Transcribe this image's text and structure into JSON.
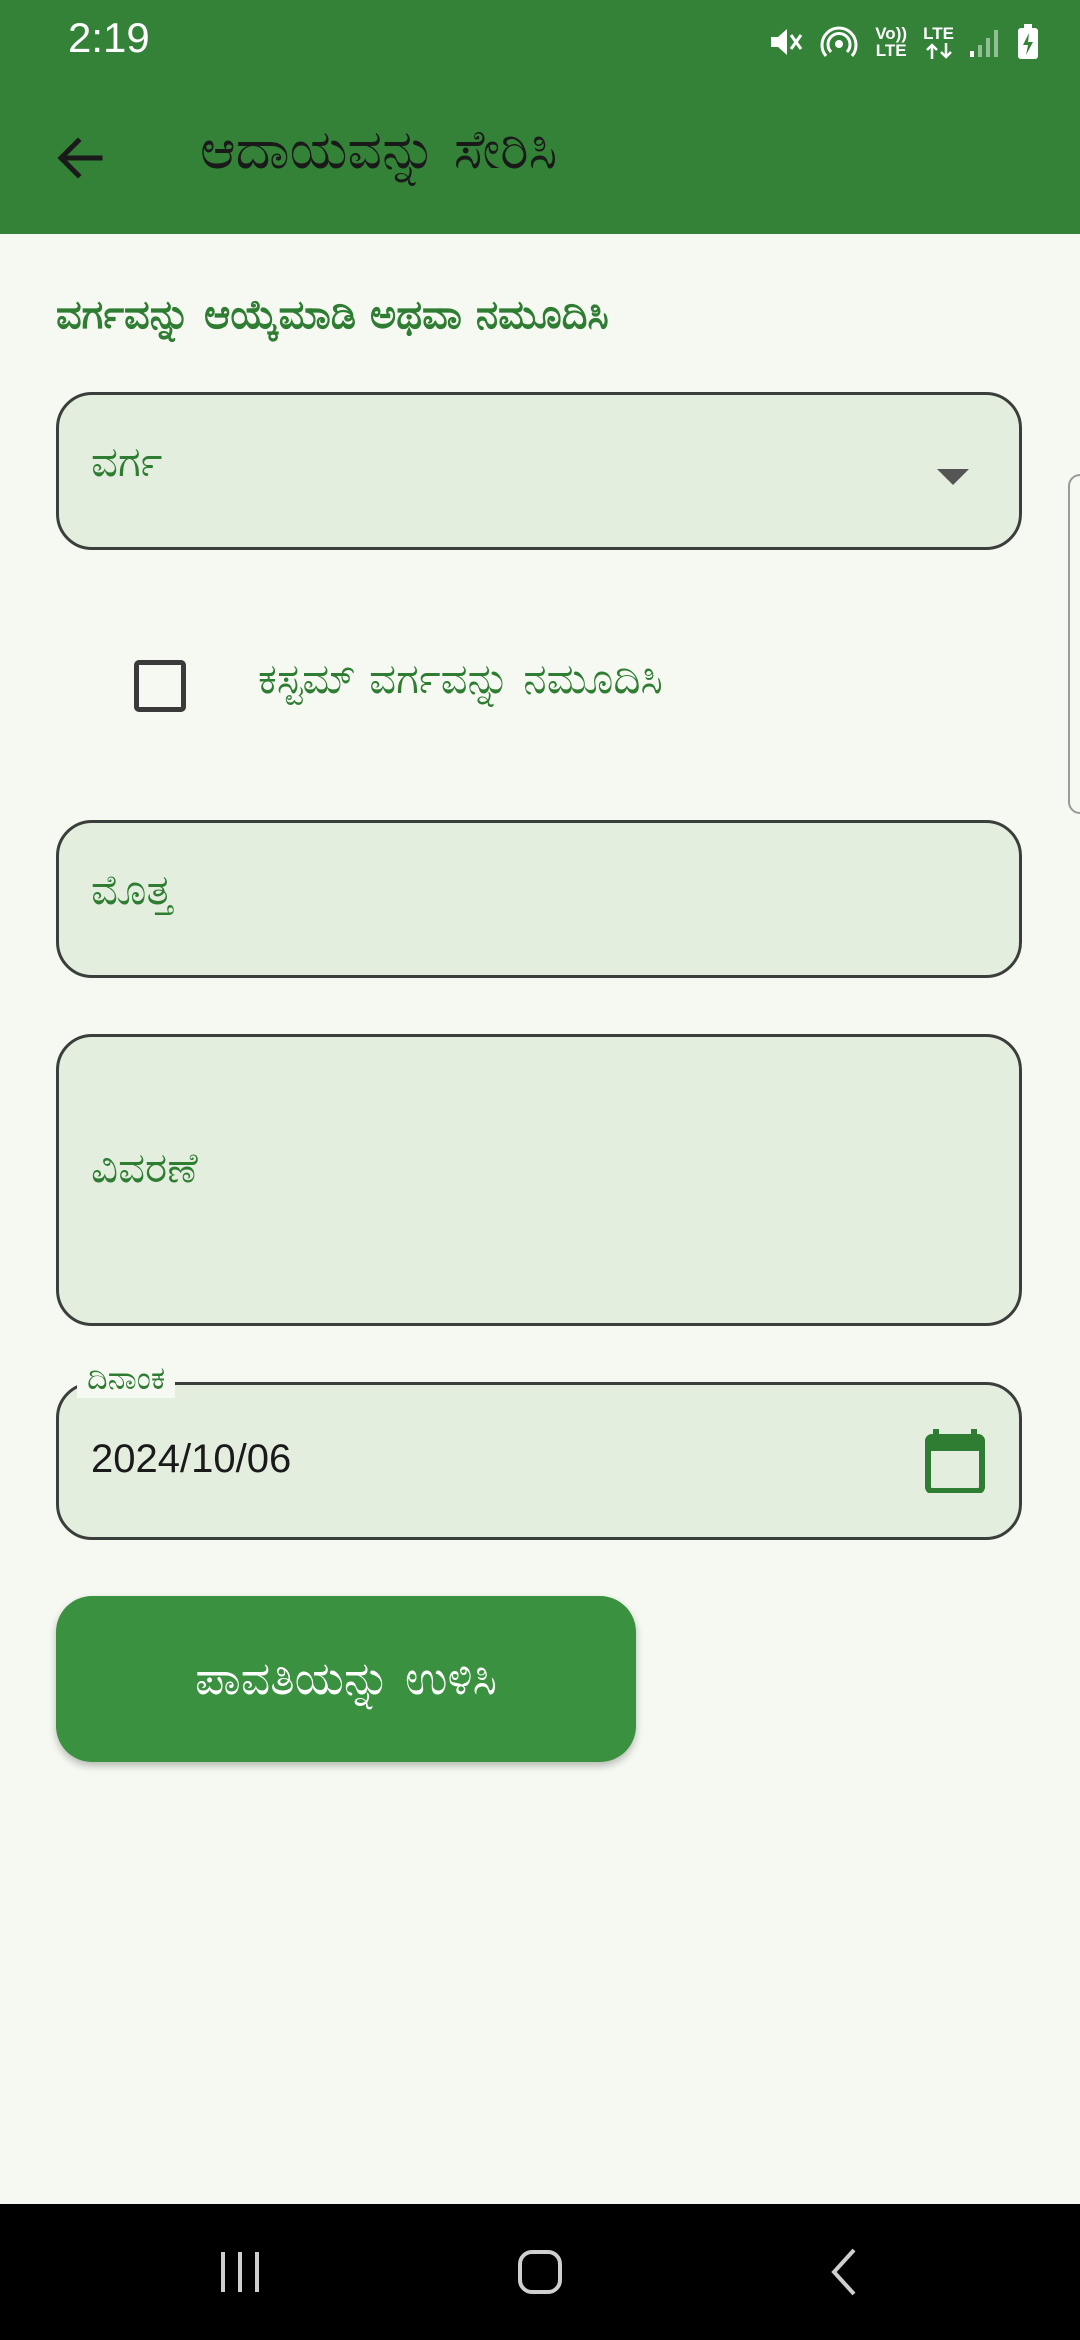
{
  "status_bar": {
    "time": "2:19",
    "icons": [
      "mute-icon",
      "hotspot-icon",
      "volte-icon",
      "lte-icon",
      "signal-icon",
      "battery-charging-icon"
    ],
    "volte_label": "Vo)) LTE",
    "lte_label": "LTE"
  },
  "app_bar": {
    "title": "ಆದಾಯವನ್ನು ಸೇರಿಸಿ",
    "background": "#338238"
  },
  "form": {
    "section_label": "ವರ್ಗವನ್ನು ಆಯ್ಕೆಮಾಡಿ ಅಥವಾ ನಮೂದಿಸಿ",
    "category_placeholder": "ವರ್ಗ",
    "custom_category_label": "ಕಸ್ಟಮ್ ವರ್ಗವನ್ನು ನಮೂದಿಸಿ",
    "custom_category_checked": false,
    "amount_placeholder": "ಮೊತ್ತ",
    "description_placeholder": "ವಿವರಣೆ",
    "date_label": "ದಿನಾಂಕ",
    "date_value": "2024/10/06",
    "save_button": "ಪಾವತಿಯನ್ನು ಉಳಿಸಿ"
  },
  "colors": {
    "accent": "#2E7D32",
    "field_background": "#E4EEDE",
    "page_background": "#F6F9F2",
    "button": "#3A913F"
  }
}
